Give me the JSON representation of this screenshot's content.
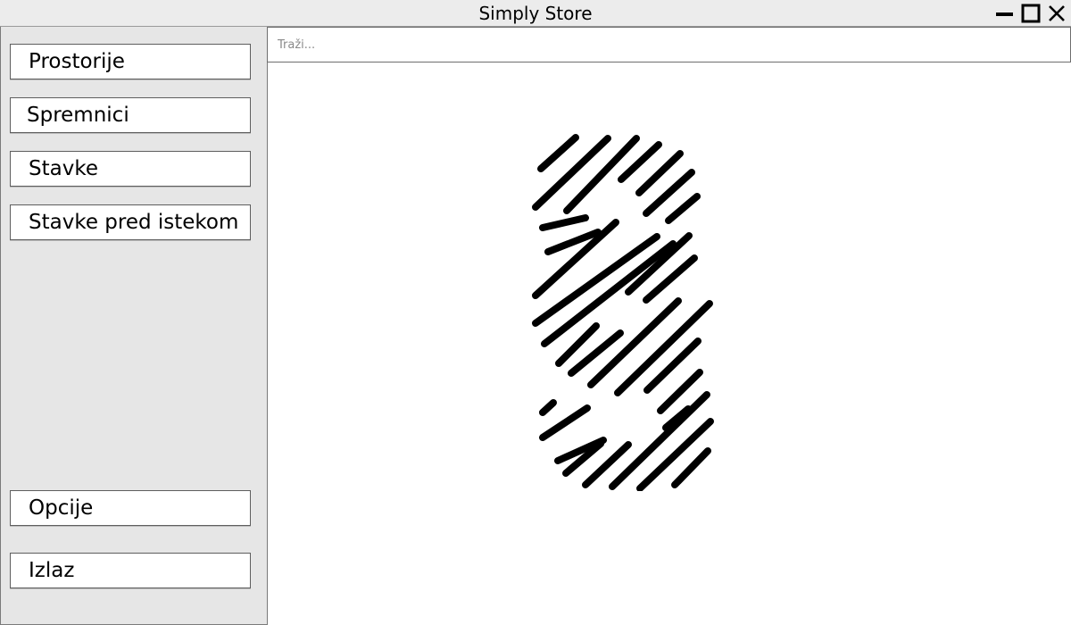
{
  "window": {
    "title": "Simply Store",
    "controls": [
      "minimize-icon",
      "maximize-icon",
      "close-icon"
    ]
  },
  "sidebar": {
    "items": [
      {
        "label": "Prostorije"
      },
      {
        "label": "Spremnici"
      },
      {
        "label": "Stavke"
      },
      {
        "label": "Stavke pred istekom"
      }
    ],
    "bottom_items": [
      {
        "label": "Opcije"
      },
      {
        "label": "Izlaz"
      }
    ]
  },
  "search": {
    "placeholder": "Traži...",
    "value": ""
  },
  "logo": {
    "icon": "striped-s-logo-icon",
    "color": "#000000"
  },
  "colors": {
    "titlebar": "#ececec",
    "sidebar": "#e6e6e6",
    "button_bg": "#ffffff",
    "button_border": "#5e5e5e"
  }
}
